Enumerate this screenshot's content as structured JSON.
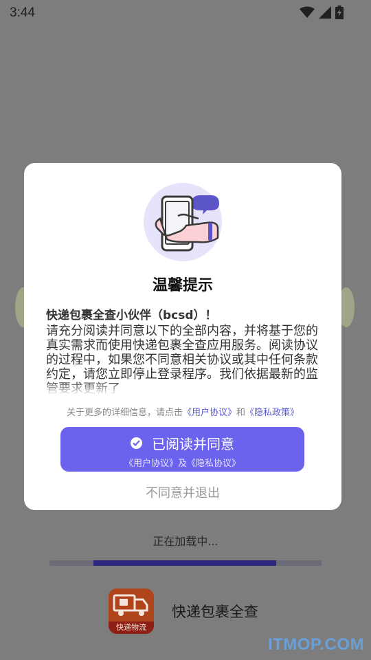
{
  "status_bar": {
    "time": "3:44"
  },
  "background": {
    "loading_text": "正在加载中...",
    "progress": 0.67,
    "app_name": "快递包裹全查",
    "app_icon_label": "快递物流",
    "watermark": "ITMOP.COM"
  },
  "dialog": {
    "title": "温馨提示",
    "greeting": "快递包裹全查小伙伴（bcsd）！",
    "body": "请充分阅读并同意以下的全部内容，并将基于您的真实需求而使用快递包裹全查应用服务。阅读协议的过程中，如果您不同意相关协议或其中任何条款约定，请您立即停止登录程序。我们依据最新的监管要求更新了",
    "links_prefix": "关于更多的详细信息，请点击",
    "user_agreement_link": "《用户协议》",
    "links_and": "和",
    "privacy_policy_link": "《隐私政策》",
    "agree_label": "已阅读并同意",
    "agree_sub": "《用户协议》及《隐私协议》",
    "decline_label": "不同意并退出"
  },
  "colors": {
    "accent": "#6b63ee",
    "link": "#5b5bd6",
    "overlay": "#7d7d7d",
    "progress_fill": "#2c2880"
  }
}
